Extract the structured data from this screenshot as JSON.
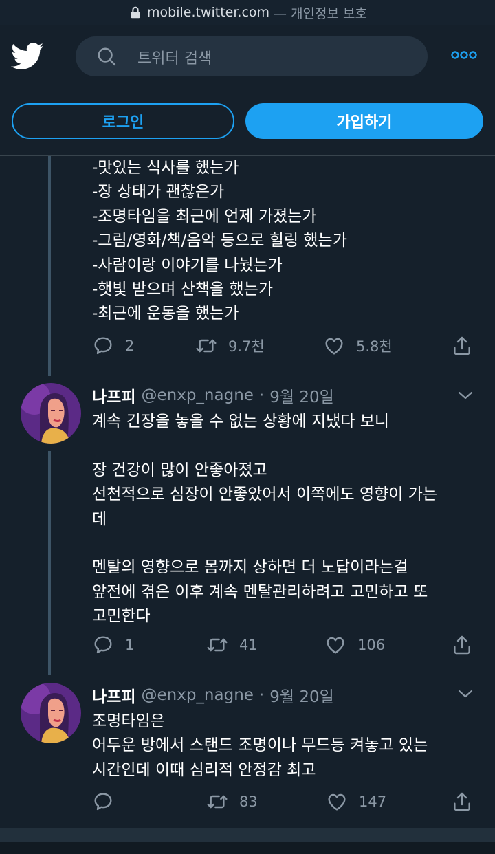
{
  "browser": {
    "domain": "mobile.twitter.com",
    "note": "— 개인정보 보호"
  },
  "search": {
    "placeholder": "트위터 검색"
  },
  "auth": {
    "login": "로그인",
    "signup": "가입하기"
  },
  "tweets": [
    {
      "text": "-맛있는 식사를 했는가\n-장 상태가 괜찮은가\n-조명타임을 최근에 언제 가졌는가\n-그림/영화/책/음악 등으로 힐링 했는가\n-사람이랑 이야기를 나눴는가\n-햇빛 받으며 산책을 했는가\n-최근에 운동을 했는가",
      "replies": "2",
      "retweets": "9.7천",
      "likes": "5.8천"
    },
    {
      "name": "나프피",
      "handle": "@enxp_nagne",
      "dot": "·",
      "date": "9월 20일",
      "text": "계속 긴장을 놓을 수 없는 상황에 지냈다 보니\n\n장 건강이 많이 안좋아졌고\n선천적으로 심장이 안좋았어서 이쪽에도 영향이 가는\n데\n\n멘탈의 영향으로 몸까지 상하면 더 노답이라는걸\n앞전에 겪은 이후 계속 멘탈관리하려고 고민하고 또\n고민한다",
      "replies": "1",
      "retweets": "41",
      "likes": "106"
    },
    {
      "name": "나프피",
      "handle": "@enxp_nagne",
      "dot": "·",
      "date": "9월 20일",
      "text": "조명타임은\n어두운 방에서 스탠드 조명이나 무드등 켜놓고 있는\n시간인데 이때 심리적 안정감 최고",
      "replies": "",
      "retweets": "83",
      "likes": "147"
    }
  ],
  "colors": {
    "background": "#15202b",
    "accent": "#1da1f2",
    "muted": "#8b98a5"
  }
}
